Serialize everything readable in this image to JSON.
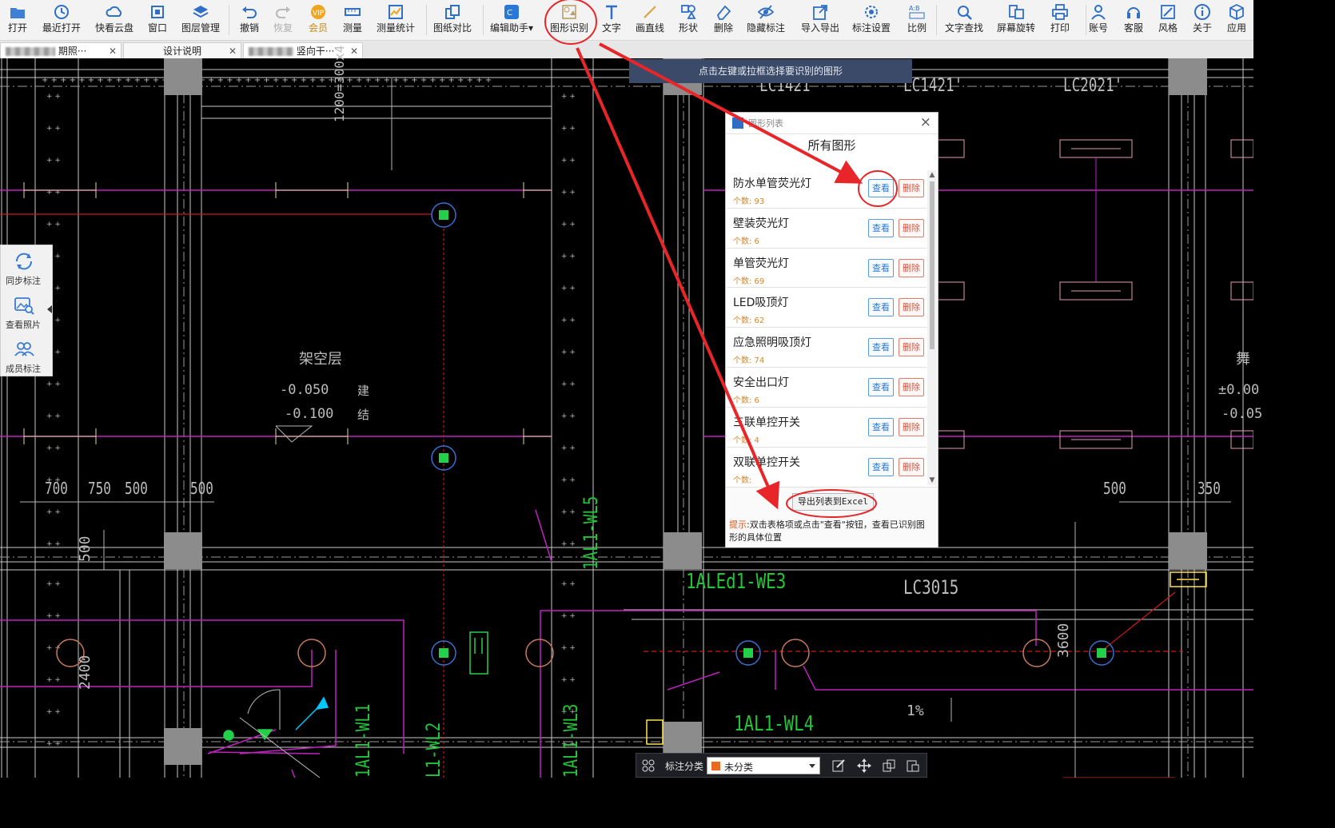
{
  "toolbar": {
    "items": [
      {
        "label": "打开",
        "icon": "open-folder-icon"
      },
      {
        "label": "最近打开",
        "icon": "recent-clock-icon"
      },
      {
        "label": "快看云盘",
        "icon": "cloud-icon"
      },
      {
        "label": "窗口",
        "icon": "window-icon"
      },
      {
        "label": "图层管理",
        "icon": "layers-icon"
      },
      {
        "label": "撤销",
        "icon": "undo-icon"
      },
      {
        "label": "恢复",
        "icon": "redo-icon"
      },
      {
        "label": "会员",
        "icon": "vip-icon"
      },
      {
        "label": "测量",
        "icon": "ruler-icon"
      },
      {
        "label": "测量统计",
        "icon": "measure-stats-icon"
      },
      {
        "label": "图纸对比",
        "icon": "compare-icon"
      },
      {
        "label": "编辑助手▾",
        "icon": "edit-assistant-icon"
      },
      {
        "label": "图形识别",
        "icon": "shape-recognize-icon"
      },
      {
        "label": "文字",
        "icon": "text-icon"
      },
      {
        "label": "画直线",
        "icon": "line-icon"
      },
      {
        "label": "形状",
        "icon": "shapes-icon"
      },
      {
        "label": "删除",
        "icon": "eraser-icon"
      },
      {
        "label": "隐藏标注",
        "icon": "hide-eye-icon"
      },
      {
        "label": "导入导出",
        "icon": "import-export-icon"
      },
      {
        "label": "标注设置",
        "icon": "annotation-settings-icon"
      },
      {
        "label": "比例",
        "icon": "scale-icon"
      },
      {
        "label": "文字查找",
        "icon": "text-search-icon"
      },
      {
        "label": "屏幕旋转",
        "icon": "rotate-screen-icon"
      },
      {
        "label": "打印",
        "icon": "print-icon"
      },
      {
        "label": "账号",
        "icon": "account-icon"
      },
      {
        "label": "客服",
        "icon": "headset-icon"
      },
      {
        "label": "风格",
        "icon": "style-icon"
      },
      {
        "label": "关于",
        "icon": "info-icon"
      },
      {
        "label": "应用",
        "icon": "apps-cube-icon"
      }
    ]
  },
  "tabs": [
    {
      "label": "期照···"
    },
    {
      "label": "设计说明"
    },
    {
      "label": "竖向干···"
    }
  ],
  "hint_banner": "点击左键或拉框选择要识别的图形",
  "left_tools": [
    {
      "label": "同步标注",
      "icon": "sync-icon"
    },
    {
      "label": "查看照片",
      "icon": "photo-view-icon"
    },
    {
      "label": "成员标注",
      "icon": "members-icon"
    }
  ],
  "dialog": {
    "title": "图形列表",
    "header": "所有图形",
    "count_prefix": "个数: ",
    "view_label": "查看",
    "delete_label": "删除",
    "items": [
      {
        "name": "防水单管荧光灯",
        "count": "个数: 93"
      },
      {
        "name": "壁装荧光灯",
        "count": "个数: 6"
      },
      {
        "name": "单管荧光灯",
        "count": "个数: 69"
      },
      {
        "name": "LED吸顶灯",
        "count": "个数: 62"
      },
      {
        "name": "应急照明吸顶灯",
        "count": "个数: 74"
      },
      {
        "name": "安全出口灯",
        "count": "个数: 6"
      },
      {
        "name": "三联单控开关",
        "count": "个数: 4"
      },
      {
        "name": "双联单控开关",
        "count": "个数: "
      }
    ],
    "export_label": "导出列表到Excel",
    "tip_key": "提示",
    "tip_text": ":双击表格项或点击\"查看\"按钮，查看已识别图形的具体位置"
  },
  "bottom_bar": {
    "category_label": "标注分类",
    "category_value": "未分类"
  },
  "cad_labels": {
    "lc1421_a": "LC1421",
    "lc1421_b": "LC1421'",
    "lc2021": "LC2021'",
    "dim_1200": "1200=300x4",
    "kong": "架空层",
    "elev1": "-0.050",
    "elev2": "-0.100",
    "jian": "建",
    "jie": "结",
    "d700": "700",
    "d750": "750",
    "d500a": "500",
    "d500b": "500",
    "d500c": "500",
    "d500d": "500",
    "d350": "350",
    "d2400": "2400",
    "d3600": "3600",
    "wl5": "1AL1-WL5",
    "we3": "1ALEd1-WE3",
    "lc3015": "LC3015",
    "wl1": "1AL1-WL1",
    "wl2": "L1-WL2",
    "wl3": "1AL1-WL3",
    "wl4": "1AL1-WL4",
    "pct": "1%",
    "elev_right1": "±0.00",
    "elev_right2": "-0.05",
    "right_char": "舞"
  },
  "colors": {
    "accent_blue": "#2b78d0",
    "delete_red": "#e0503a",
    "count_orange": "#d3862a",
    "annotation_red": "#e8262a",
    "cad_magenta": "#c020c0",
    "cad_green": "#00c23a",
    "cad_grey": "#b4b4b4"
  }
}
